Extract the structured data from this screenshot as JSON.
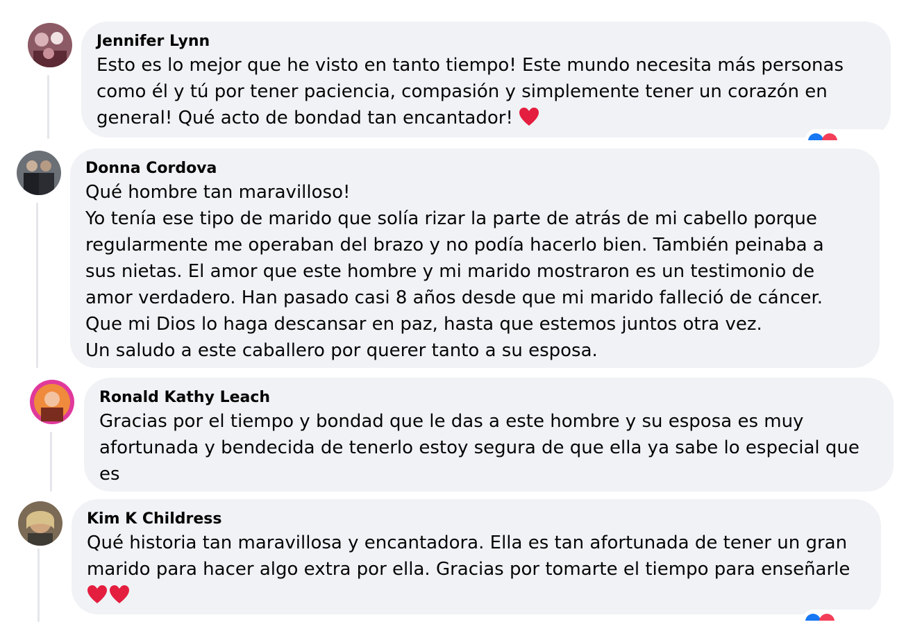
{
  "colors": {
    "bubble": "#f0f2f5",
    "text": "#050505",
    "heart": "#e41e3f",
    "like_blue": "#1877f2",
    "love_red": "#f33e58"
  },
  "comments": [
    {
      "author": "Jennifer Lynn",
      "lines": [
        "Esto es lo mejor que he visto en tanto tiempo! Este mundo necesita más personas",
        "como él y tú por tener paciencia, compasión y simplemente tener un corazón en",
        "general! Qué acto de bondad tan encantador!"
      ],
      "trailing_icons": [
        "heart-icon"
      ],
      "reactions": [
        "like-icon",
        "love-icon"
      ]
    },
    {
      "author": "Donna Cordova",
      "lines": [
        "Qué hombre tan maravilloso!",
        "Yo tenía ese tipo de marido que solía rizar la parte de atrás de mi cabello porque",
        "regularmente me operaban del brazo y no podía hacerlo bien. También peinaba a",
        "sus nietas. El amor que este hombre y mi marido mostraron es un testimonio de",
        "amor verdadero. Han pasado casi 8 años desde que mi marido falleció de cáncer.",
        "Que mi Dios lo haga descansar en paz, hasta que estemos juntos otra vez.",
        "Un saludo a este caballero por querer tanto a su esposa."
      ],
      "trailing_icons": [],
      "reactions": []
    },
    {
      "author": "Ronald Kathy Leach",
      "lines": [
        "Gracias por el tiempo y bondad que le das a este hombre y su esposa es muy",
        "afortunada y bendecida de tenerlo estoy segura de que ella ya sabe lo especial que",
        "es"
      ],
      "trailing_icons": [],
      "reactions": []
    },
    {
      "author": "Kim K Childress",
      "lines": [
        "Qué historia tan maravillosa y encantadora. Ella es tan afortunada de tener un gran",
        "marido para hacer algo extra por ella. Gracias por tomarte el tiempo para enseñarle"
      ],
      "trailing_icons": [
        "heart-icon",
        "heart-icon"
      ],
      "reactions": [
        "like-icon",
        "love-icon"
      ]
    }
  ]
}
